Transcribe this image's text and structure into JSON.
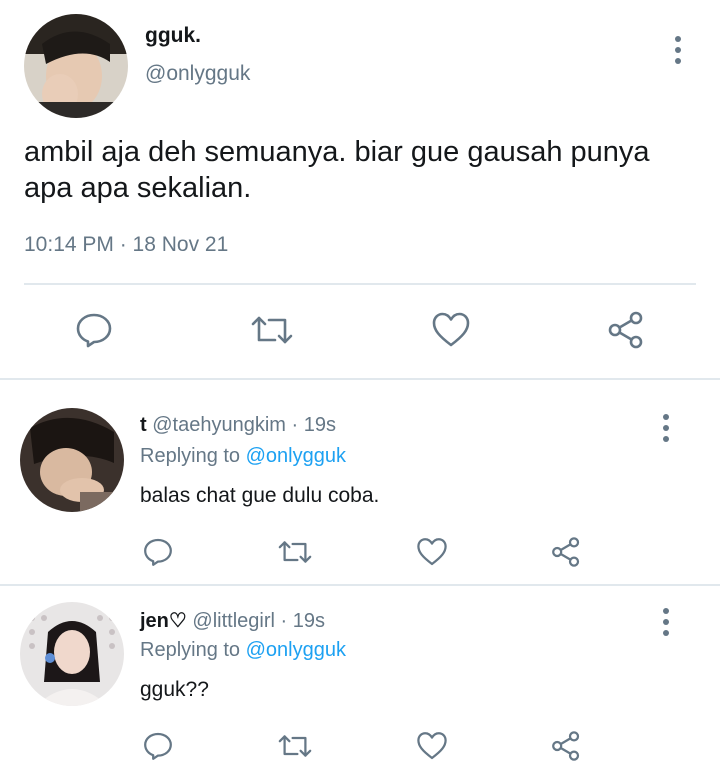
{
  "main_tweet": {
    "display_name": "gguk.",
    "handle": "@onlygguk",
    "text": "ambil aja deh semuanya. biar gue gausah punya apa apa sekalian.",
    "timestamp": "10:14 PM · 18 Nov 21",
    "actions": [
      "reply-icon",
      "retweet-icon",
      "like-icon",
      "share-icon"
    ]
  },
  "replies": [
    {
      "display_name": "t",
      "handle": "@taehyungkim",
      "age": "· 19s",
      "replying_label": "Replying to",
      "replying_to": "@onlygguk",
      "text": "balas chat gue dulu coba."
    },
    {
      "display_name": "jen♡",
      "handle": "@littlegirl",
      "age": "· 19s",
      "replying_label": "Replying to",
      "replying_to": "@onlygguk",
      "text": "gguk??"
    }
  ],
  "colors": {
    "primary_text": "#14171a",
    "secondary_text": "#657786",
    "link": "#1da1f2",
    "divider": "#e1e8ed"
  }
}
